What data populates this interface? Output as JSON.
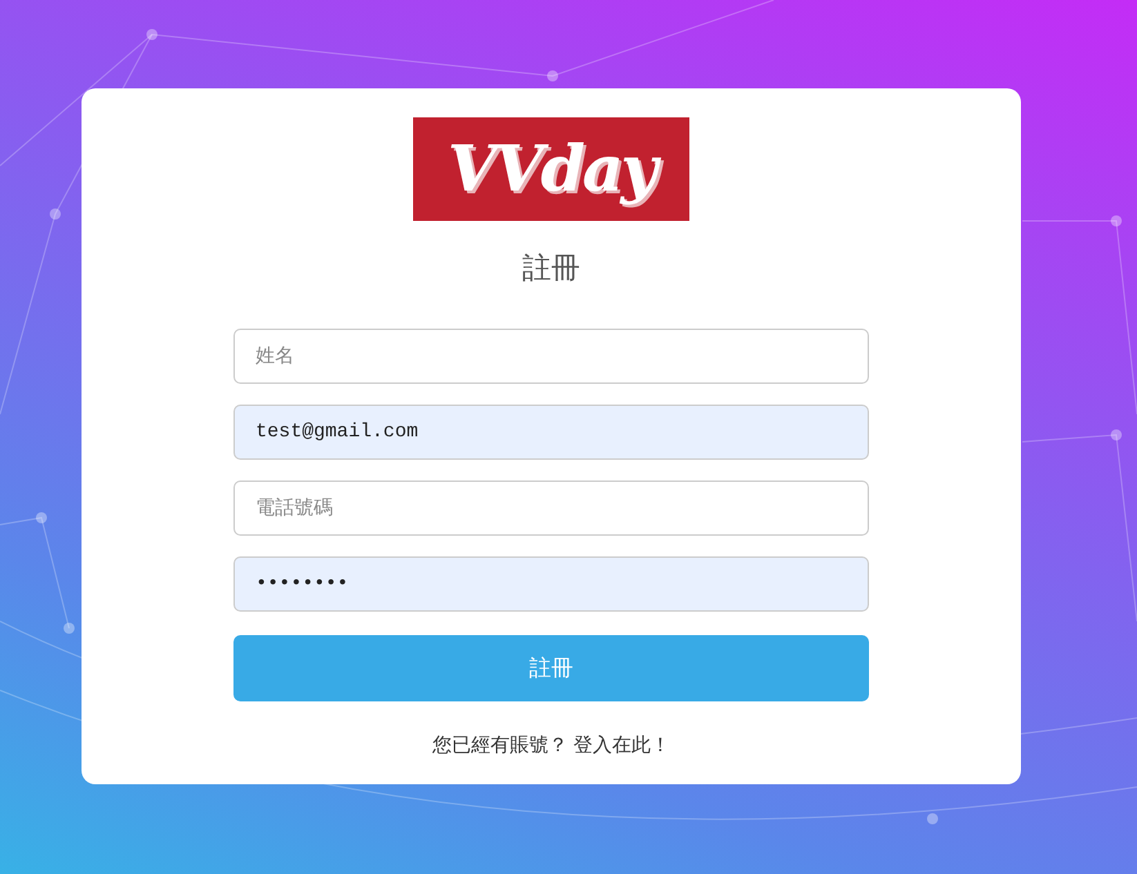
{
  "logo": {
    "text": "VVday"
  },
  "title": "註冊",
  "fields": [
    {
      "placeholder": "姓名",
      "autofilled": false
    },
    {
      "value": "test@gmail.com",
      "autofilled": true
    },
    {
      "placeholder": "電話號碼",
      "autofilled": false
    },
    {
      "value": "••••••••",
      "autofilled": true
    }
  ],
  "submit_button": "註冊",
  "footer": {
    "text": "您已經有賬號？",
    "link": "登入在此！"
  }
}
